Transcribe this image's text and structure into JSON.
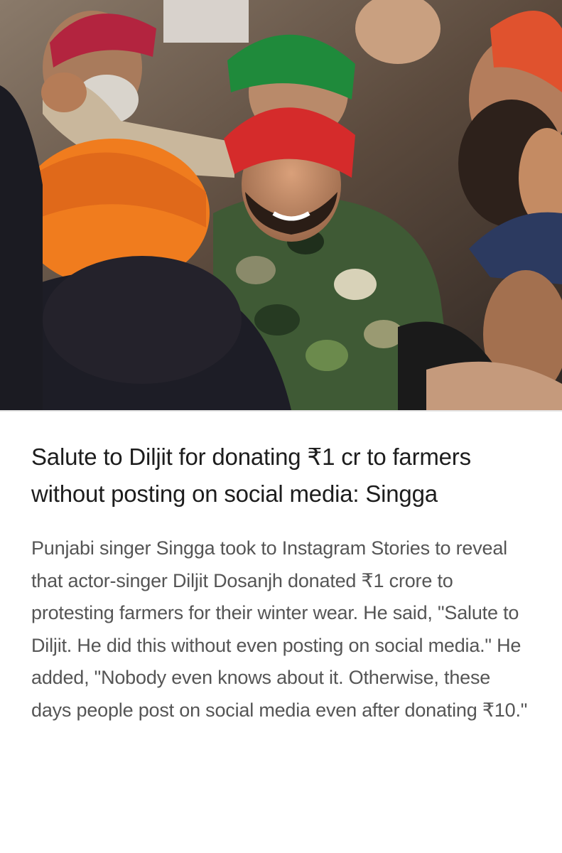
{
  "article": {
    "headline": "Salute to Diljit for donating ₹1 cr to farmers without posting on social media: Singga",
    "summary": "Punjabi singer Singga took to Instagram Stories to reveal that actor-singer Diljit Dosanjh donated ₹1 crore to protesting farmers for their winter wear. He said, \"Salute to Diljit. He did this without even posting on social media.\" He added, \"Nobody even knows about it. Otherwise, these days people post on social media even after donating ₹10.\""
  },
  "colors": {
    "headline": "#1d1d1d",
    "summary": "#555555",
    "background": "#ffffff"
  }
}
